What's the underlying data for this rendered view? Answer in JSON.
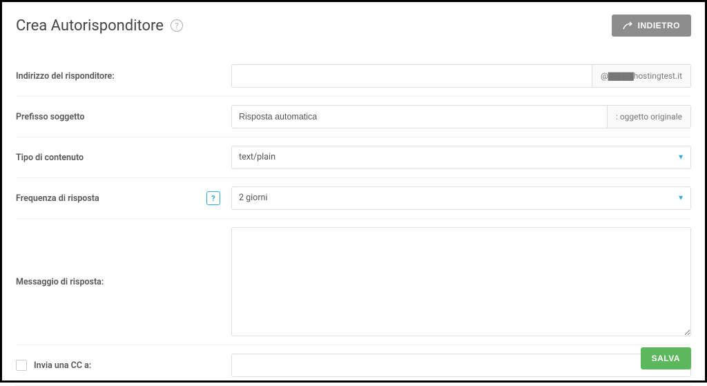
{
  "header": {
    "title": "Crea Autorisponditore",
    "back_label": "INDIETRO"
  },
  "form": {
    "responder_address_label": "Indirizzo del risponditore:",
    "responder_address_value": "",
    "responder_address_suffix": "@▇▇▇▇hostingtest.it",
    "subject_prefix_label": "Prefisso soggetto",
    "subject_prefix_value": "Risposta automatica",
    "subject_prefix_suffix": ": oggetto originale",
    "content_type_label": "Tipo di contenuto",
    "content_type_value": "text/plain",
    "response_frequency_label": "Frequenza di risposta",
    "response_frequency_value": "2 giorni",
    "response_message_label": "Messaggio di risposta:",
    "response_message_value": "",
    "send_cc_label": "Invia una CC a:",
    "send_cc_value": ""
  },
  "footer": {
    "save_label": "SALVA"
  }
}
